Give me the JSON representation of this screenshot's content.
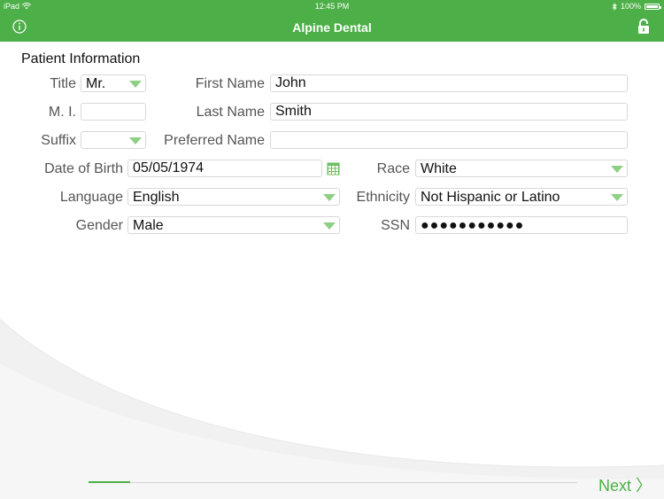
{
  "status_bar": {
    "device": "iPad",
    "time": "12:45 PM",
    "battery": "100%",
    "icons": [
      "wifi-icon",
      "bluetooth-icon",
      "battery-icon"
    ]
  },
  "nav": {
    "title": "Alpine Dental",
    "left_icon": "info-icon",
    "right_icon": "unlock-icon"
  },
  "form": {
    "section_title": "Patient Information",
    "title_label": "Title",
    "title_value": "Mr.",
    "mi_label": "M. I.",
    "mi_value": "",
    "suffix_label": "Suffix",
    "suffix_value": "",
    "first_name_label": "First Name",
    "first_name_value": "John",
    "last_name_label": "Last Name",
    "last_name_value": "Smith",
    "preferred_name_label": "Preferred Name",
    "preferred_name_value": "",
    "dob_label": "Date of Birth",
    "dob_value": "05/05/1974",
    "race_label": "Race",
    "race_value": "White",
    "language_label": "Language",
    "language_value": "English",
    "ethnicity_label": "Ethnicity",
    "ethnicity_value": "Not Hispanic or Latino",
    "gender_label": "Gender",
    "gender_value": "Male",
    "ssn_label": "SSN",
    "ssn_value": "●●●●●●●●●●●"
  },
  "footer": {
    "next_label": "Next 〉",
    "progress_fraction": 0.085
  },
  "colors": {
    "accent": "#4caf47",
    "dropdown_arrow": "#8fcf84",
    "label": "#555555"
  }
}
